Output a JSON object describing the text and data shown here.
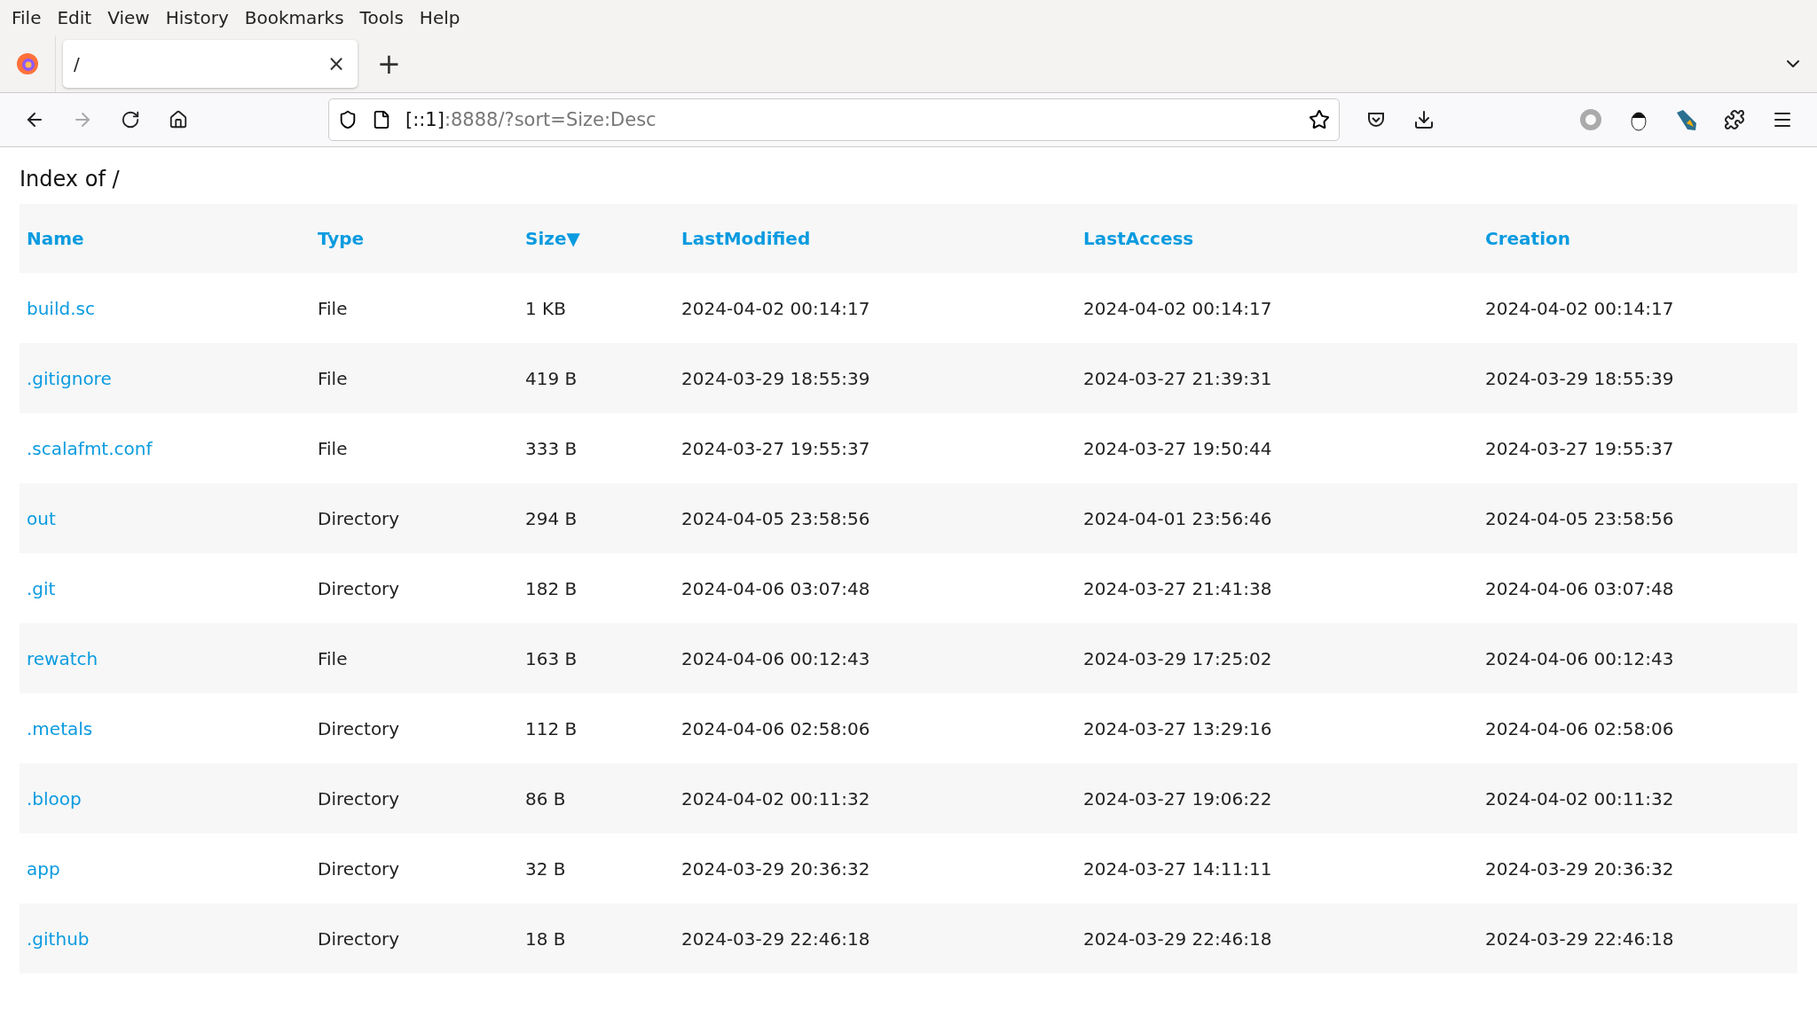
{
  "menu": [
    "File",
    "Edit",
    "View",
    "History",
    "Bookmarks",
    "Tools",
    "Help"
  ],
  "tabs": [
    {
      "title": "/",
      "close": "×",
      "selected": true
    }
  ],
  "new_tab": "+",
  "address": {
    "host": "[::1]",
    "rest": ":8888/?sort=Size:Desc"
  },
  "page": {
    "title": "Index of /",
    "columns": [
      {
        "label": "Name"
      },
      {
        "label": "Type"
      },
      {
        "label": "Size",
        "indicator": "▼"
      },
      {
        "label": "LastModified"
      },
      {
        "label": "LastAccess"
      },
      {
        "label": "Creation"
      }
    ],
    "rows": [
      [
        "build.sc",
        "File",
        "1 KB",
        "2024-04-02 00:14:17",
        "2024-04-02 00:14:17",
        "2024-04-02 00:14:17"
      ],
      [
        ".gitignore",
        "File",
        "419 B",
        "2024-03-29 18:55:39",
        "2024-03-27 21:39:31",
        "2024-03-29 18:55:39"
      ],
      [
        ".scalafmt.conf",
        "File",
        "333 B",
        "2024-03-27 19:55:37",
        "2024-03-27 19:50:44",
        "2024-03-27 19:55:37"
      ],
      [
        "out",
        "Directory",
        "294 B",
        "2024-04-05 23:58:56",
        "2024-04-01 23:56:46",
        "2024-04-05 23:58:56"
      ],
      [
        ".git",
        "Directory",
        "182 B",
        "2024-04-06 03:07:48",
        "2024-03-27 21:41:38",
        "2024-04-06 03:07:48"
      ],
      [
        "rewatch",
        "File",
        "163 B",
        "2024-04-06 00:12:43",
        "2024-03-29 17:25:02",
        "2024-04-06 00:12:43"
      ],
      [
        ".metals",
        "Directory",
        "112 B",
        "2024-04-06 02:58:06",
        "2024-03-27 13:29:16",
        "2024-04-06 02:58:06"
      ],
      [
        ".bloop",
        "Directory",
        "86 B",
        "2024-04-02 00:11:32",
        "2024-03-27 19:06:22",
        "2024-04-02 00:11:32"
      ],
      [
        "app",
        "Directory",
        "32 B",
        "2024-03-29 20:36:32",
        "2024-03-27 14:11:11",
        "2024-03-29 20:36:32"
      ],
      [
        ".github",
        "Directory",
        "18 B",
        "2024-03-29 22:46:18",
        "2024-03-29 22:46:18",
        "2024-03-29 22:46:18"
      ]
    ]
  }
}
